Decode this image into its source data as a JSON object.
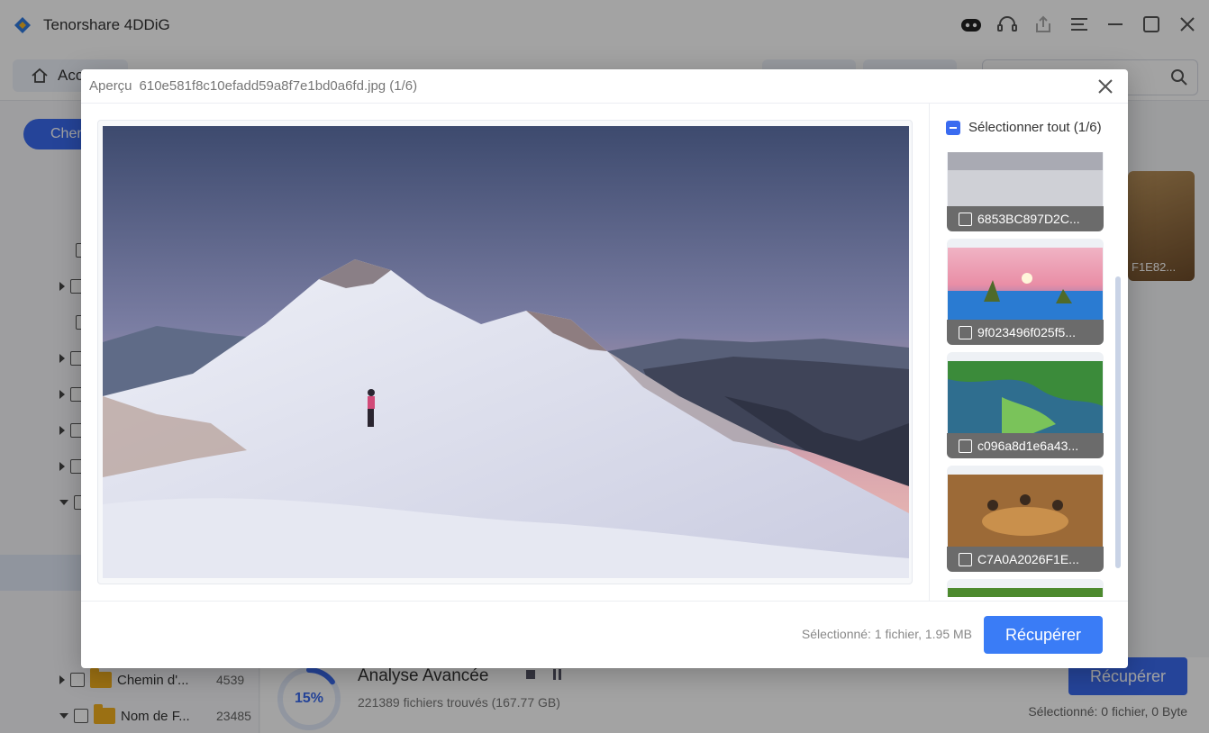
{
  "app": {
    "title": "Tenorshare 4DDiG"
  },
  "toolbar": {
    "home_tab": "Accueil",
    "left_tab": "Chemin",
    "search_placeholder": ""
  },
  "tree": [
    {
      "label": "Chemin d'...",
      "count": "4539"
    },
    {
      "label": "Nom de F...",
      "count": "23485"
    }
  ],
  "scan": {
    "percent": "15%",
    "progress": 0.15,
    "title": "Analyse Avancée",
    "subtitle": "221389 fichiers trouvés (167.77 GB)"
  },
  "background_footer": {
    "recover_label": "Récupérer",
    "selected_text": "Sélectionné: 0 fichier, 0 Byte",
    "thumb_caption": "F1E82..."
  },
  "preview": {
    "header_label": "Aperçu",
    "filename": "610e581f8c10efadd59a8f7e1bd0a6fd.jpg (1/6)",
    "select_all": "Sélectionner tout (1/6)",
    "thumbnails": [
      {
        "name": "6853BC897D2C...",
        "scene": "clouds"
      },
      {
        "name": "9f023496f025f5...",
        "scene": "pink-sunset"
      },
      {
        "name": "c096a8d1e6a43...",
        "scene": "coast"
      },
      {
        "name": "C7A0A2026F1E...",
        "scene": "dinner"
      },
      {
        "name": "",
        "scene": "roses"
      }
    ],
    "selected_text": "Sélectionné: 1 fichier, 1.95 MB",
    "recover_label": "Récupérer"
  },
  "colors": {
    "accent": "#3a6bf0",
    "recover": "#3a7cf6"
  }
}
